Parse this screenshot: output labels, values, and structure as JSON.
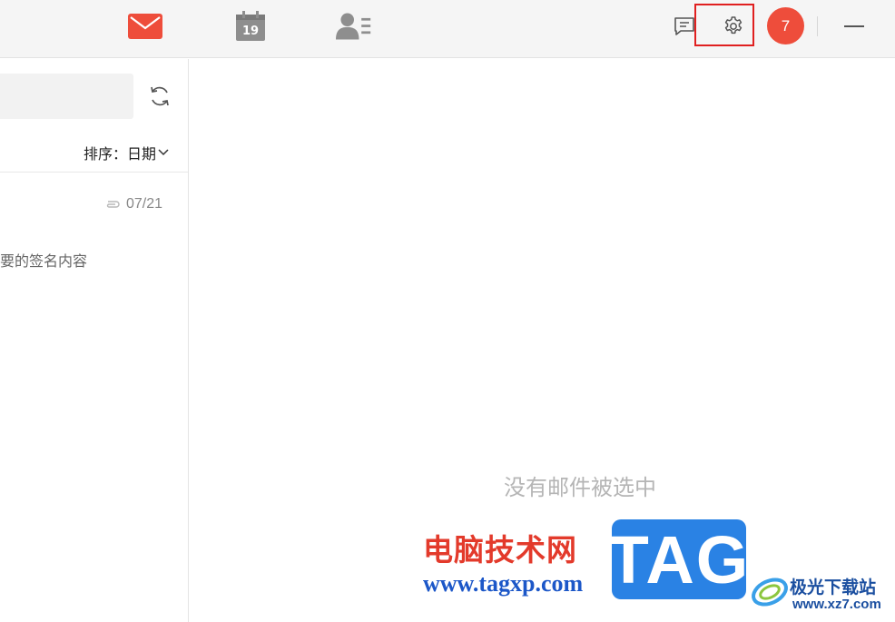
{
  "topbar": {
    "nav": [
      {
        "name": "mail",
        "icon": "mail-icon",
        "active": true,
        "color": "#ee4d3b"
      },
      {
        "name": "calendar",
        "icon": "calendar-icon",
        "day": "19"
      },
      {
        "name": "contacts",
        "icon": "contacts-icon"
      }
    ],
    "tools": [
      {
        "name": "chat",
        "icon": "chat-bubble-icon"
      },
      {
        "name": "settings",
        "icon": "gear-icon",
        "highlighted": true
      }
    ],
    "avatar_label": "7",
    "avatar_color": "#ee4d3b",
    "highlight_color": "#e02020"
  },
  "list": {
    "search_placeholder": "",
    "sort_label": "排序：日期",
    "items": [
      {
        "date": "07/21",
        "preview": "要的签名内容",
        "has_attachment": true
      }
    ]
  },
  "main": {
    "empty_text": "没有邮件被选中"
  },
  "watermark": {
    "title": "电脑技术网",
    "url": "www.tagxp.com",
    "tag": "TAG",
    "site_name": "极光下载站",
    "site_url": "www.xz7.com"
  }
}
